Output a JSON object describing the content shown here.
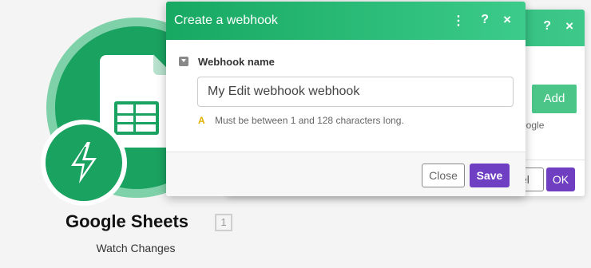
{
  "module": {
    "title": "Google Sheets",
    "count": "1",
    "subtitle": "Watch Changes",
    "icons": {
      "app": "google-sheets-icon",
      "trigger": "lightning-bolt-icon"
    },
    "colors": {
      "brand": "#1aa260"
    }
  },
  "background_dialog": {
    "help_icon": "?",
    "close_icon": "×",
    "add_label": "Add",
    "partial_text": "oogle",
    "cancel_partial": "el",
    "ok_label": "OK"
  },
  "dialog": {
    "title": "Create a webhook",
    "menu_icon": "⋮",
    "help_icon": "?",
    "close_icon": "×",
    "field": {
      "label": "Webhook name",
      "value": "My Edit webhook webhook",
      "hint_icon": "A",
      "hint": "Must be between 1 and 128 characters long."
    },
    "buttons": {
      "close": "Close",
      "save": "Save"
    },
    "colors": {
      "header": "#1fb06c",
      "primary": "#6e3fc3"
    }
  }
}
